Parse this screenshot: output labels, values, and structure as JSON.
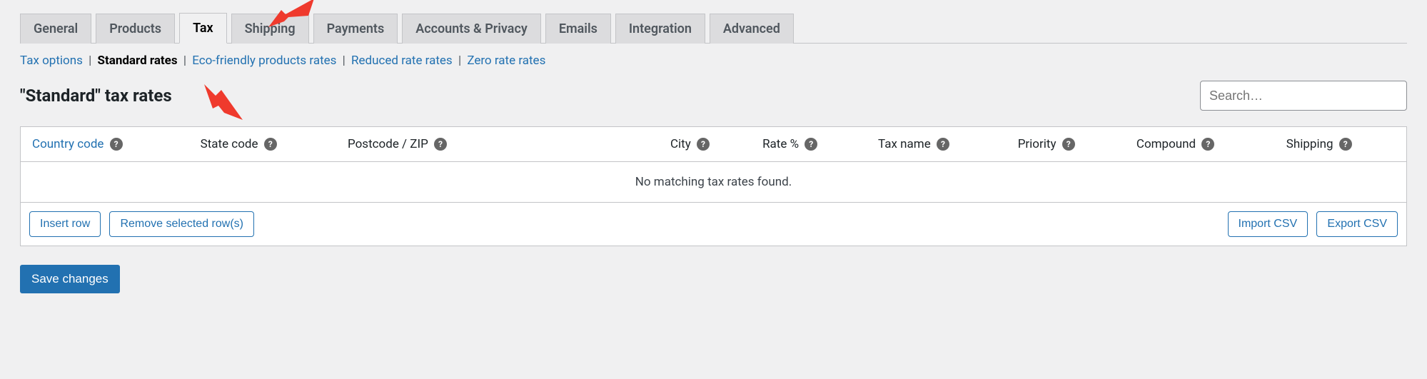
{
  "tabs": [
    {
      "label": "General"
    },
    {
      "label": "Products"
    },
    {
      "label": "Tax",
      "active": true
    },
    {
      "label": "Shipping"
    },
    {
      "label": "Payments"
    },
    {
      "label": "Accounts & Privacy"
    },
    {
      "label": "Emails"
    },
    {
      "label": "Integration"
    },
    {
      "label": "Advanced"
    }
  ],
  "subnav": {
    "items": [
      {
        "label": "Tax options"
      },
      {
        "label": "Standard rates",
        "current": true
      },
      {
        "label": "Eco-friendly products rates"
      },
      {
        "label": "Reduced rate rates"
      },
      {
        "label": "Zero rate rates"
      }
    ],
    "separator": "|"
  },
  "heading": "\"Standard\" tax rates",
  "search": {
    "placeholder": "Search…"
  },
  "table": {
    "columns": [
      {
        "label": "Country code"
      },
      {
        "label": "State code"
      },
      {
        "label": "Postcode / ZIP"
      },
      {
        "label": "City"
      },
      {
        "label": "Rate %"
      },
      {
        "label": "Tax name"
      },
      {
        "label": "Priority"
      },
      {
        "label": "Compound"
      },
      {
        "label": "Shipping"
      }
    ],
    "empty_message": "No matching tax rates found.",
    "footer_buttons": {
      "insert_row": "Insert row",
      "remove_rows": "Remove selected row(s)",
      "import_csv": "Import CSV",
      "export_csv": "Export CSV"
    }
  },
  "save_label": "Save changes"
}
